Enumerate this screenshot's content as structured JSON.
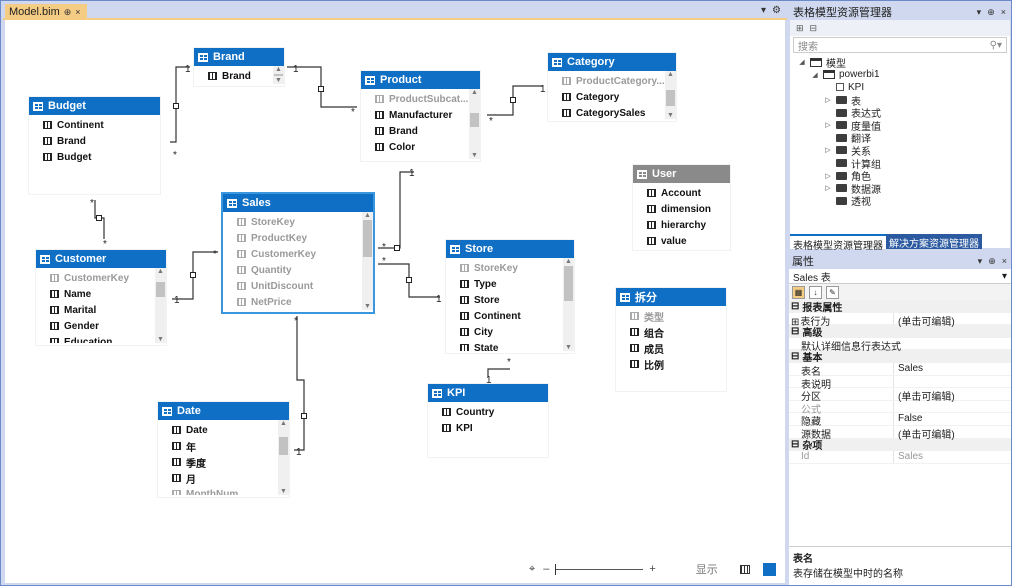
{
  "doc": {
    "tab": "Model.bim",
    "pin": "⊕",
    "close": "×"
  },
  "tables": [
    {
      "id": "brand",
      "title": "Brand",
      "fields": [
        {
          "name": "Brand",
          "hidden": false
        }
      ]
    },
    {
      "id": "budget",
      "title": "Budget",
      "fields": [
        {
          "name": "Continent",
          "hidden": false
        },
        {
          "name": "Brand",
          "hidden": false
        },
        {
          "name": "Budget",
          "hidden": false
        }
      ]
    },
    {
      "id": "product",
      "title": "Product",
      "fields": [
        {
          "name": "ProductSubcat...",
          "hidden": true
        },
        {
          "name": "Manufacturer",
          "hidden": false
        },
        {
          "name": "Brand",
          "hidden": false
        },
        {
          "name": "Color",
          "hidden": false
        },
        {
          "name": "...",
          "hidden": false
        }
      ]
    },
    {
      "id": "category",
      "title": "Category",
      "fields": [
        {
          "name": "ProductCategory...",
          "hidden": true
        },
        {
          "name": "Category",
          "hidden": false
        },
        {
          "name": "CategorySales",
          "hidden": false
        }
      ]
    },
    {
      "id": "user",
      "title": "User",
      "fields": [
        {
          "name": "Account",
          "hidden": false
        },
        {
          "name": "dimension",
          "hidden": false
        },
        {
          "name": "hierarchy",
          "hidden": false
        },
        {
          "name": "value",
          "hidden": false
        }
      ]
    },
    {
      "id": "sales",
      "title": "Sales",
      "fields": [
        {
          "name": "StoreKey",
          "hidden": true
        },
        {
          "name": "ProductKey",
          "hidden": true
        },
        {
          "name": "CustomerKey",
          "hidden": true
        },
        {
          "name": "Quantity",
          "hidden": true
        },
        {
          "name": "UnitDiscount",
          "hidden": true
        },
        {
          "name": "NetPrice",
          "hidden": true
        }
      ]
    },
    {
      "id": "customer",
      "title": "Customer",
      "fields": [
        {
          "name": "CustomerKey",
          "hidden": true
        },
        {
          "name": "Name",
          "hidden": false
        },
        {
          "name": "Marital",
          "hidden": false
        },
        {
          "name": "Gender",
          "hidden": false
        },
        {
          "name": "Education",
          "hidden": false
        }
      ]
    },
    {
      "id": "store",
      "title": "Store",
      "fields": [
        {
          "name": "StoreKey",
          "hidden": true
        },
        {
          "name": "Type",
          "hidden": false
        },
        {
          "name": "Store",
          "hidden": false
        },
        {
          "name": "Continent",
          "hidden": false
        },
        {
          "name": "City",
          "hidden": false
        },
        {
          "name": "State",
          "hidden": false
        }
      ]
    },
    {
      "id": "split",
      "title": "拆分",
      "fields": [
        {
          "name": "类型",
          "hidden": true
        },
        {
          "name": "组合",
          "hidden": false
        },
        {
          "name": "成员",
          "hidden": false
        },
        {
          "name": "比例",
          "hidden": false
        }
      ]
    },
    {
      "id": "kpi",
      "title": "KPI",
      "fields": [
        {
          "name": "Country",
          "hidden": false
        },
        {
          "name": "KPI",
          "hidden": false
        }
      ]
    },
    {
      "id": "date",
      "title": "Date",
      "fields": [
        {
          "name": "Date",
          "hidden": false
        },
        {
          "name": "年",
          "hidden": false
        },
        {
          "name": "季度",
          "hidden": false
        },
        {
          "name": "月",
          "hidden": false
        },
        {
          "name": "MonthNum",
          "hidden": true
        }
      ]
    }
  ],
  "cardinality": {
    "one": "1",
    "many": "*"
  },
  "zoom": {
    "minus": "–",
    "plus": "+",
    "show": "显示"
  },
  "tmx": {
    "title": "表格模型资源管理器",
    "search_placeholder": "搜索",
    "tree": [
      {
        "label": "模型",
        "level": 0,
        "twist": "◢",
        "icon": "model"
      },
      {
        "label": "powerbi1",
        "level": 1,
        "twist": "◢",
        "icon": "model"
      },
      {
        "label": "KPI",
        "level": 2,
        "twist": "",
        "icon": "kpi"
      },
      {
        "label": "表",
        "level": 2,
        "twist": "▷",
        "icon": "folder"
      },
      {
        "label": "表达式",
        "level": 2,
        "twist": "",
        "icon": "folder"
      },
      {
        "label": "度量值",
        "level": 2,
        "twist": "▷",
        "icon": "folder"
      },
      {
        "label": "翻译",
        "level": 2,
        "twist": "",
        "icon": "folder"
      },
      {
        "label": "关系",
        "level": 2,
        "twist": "▷",
        "icon": "folder"
      },
      {
        "label": "计算组",
        "level": 2,
        "twist": "",
        "icon": "folder"
      },
      {
        "label": "角色",
        "level": 2,
        "twist": "▷",
        "icon": "folder"
      },
      {
        "label": "数据源",
        "level": 2,
        "twist": "▷",
        "icon": "folder"
      },
      {
        "label": "透视",
        "level": 2,
        "twist": "",
        "icon": "folder"
      }
    ],
    "tab_active": "表格模型资源管理器",
    "tab_other": "解决方案资源管理器"
  },
  "props": {
    "title": "属性",
    "selected": "Sales 表",
    "rows": [
      {
        "type": "cat",
        "label": "报表属性"
      },
      {
        "type": "row",
        "k": "表行为",
        "v": "(单击可编辑)",
        "plus": true
      },
      {
        "type": "cat",
        "label": "高级"
      },
      {
        "type": "lbl",
        "k": "默认详细信息行表达式"
      },
      {
        "type": "cat",
        "label": "基本"
      },
      {
        "type": "row",
        "k": "表名",
        "v": "Sales"
      },
      {
        "type": "row",
        "k": "表说明",
        "v": ""
      },
      {
        "type": "row",
        "k": "分区",
        "v": "(单击可编辑)"
      },
      {
        "type": "row",
        "k": "公式",
        "v": "",
        "dim": true
      },
      {
        "type": "row",
        "k": "隐藏",
        "v": "False"
      },
      {
        "type": "row",
        "k": "源数据",
        "v": "(单击可编辑)"
      },
      {
        "type": "cat",
        "label": "杂项"
      },
      {
        "type": "row",
        "k": "Id",
        "v": "Sales",
        "dim": true
      }
    ],
    "desc_title": "表名",
    "desc_text": "表存储在模型中时的名称"
  }
}
